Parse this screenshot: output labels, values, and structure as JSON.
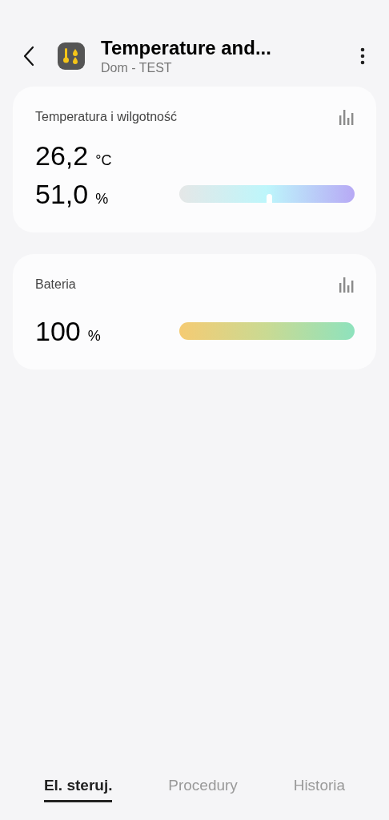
{
  "header": {
    "title": "Temperature and...",
    "subtitle": "Dom - TEST"
  },
  "cards": [
    {
      "title": "Temperatura i wilgotność",
      "readings": [
        {
          "value": "26,2",
          "unit": "°C"
        },
        {
          "value": "51,0",
          "unit": "%",
          "meter": {
            "kind": "marker",
            "level": 0.51
          }
        }
      ]
    },
    {
      "title": "Bateria",
      "readings": [
        {
          "value": "100",
          "unit": "%",
          "meter": {
            "kind": "gradient"
          }
        }
      ]
    }
  ],
  "tabs": [
    {
      "label": "El. steruj.",
      "selected": true
    },
    {
      "label": "Procedury",
      "selected": false
    },
    {
      "label": "Historia",
      "selected": false
    }
  ]
}
